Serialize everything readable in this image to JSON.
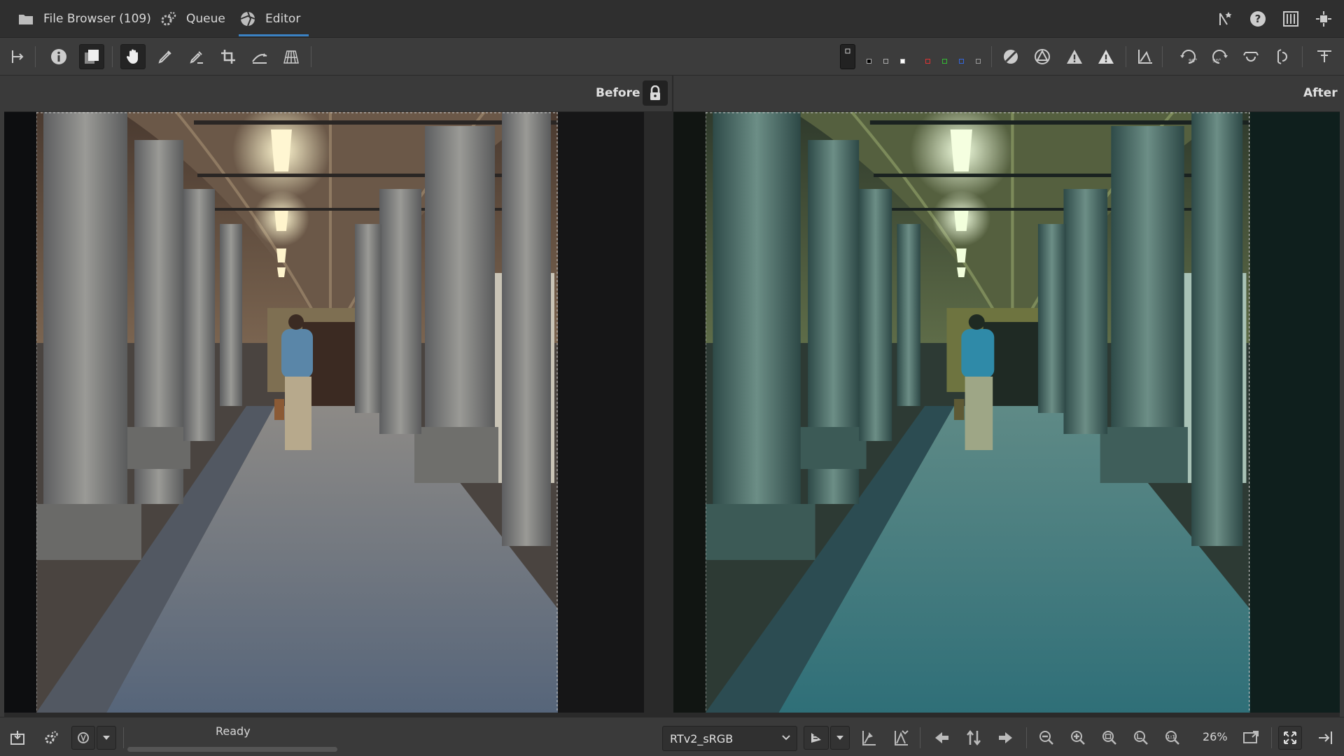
{
  "tabs": [
    {
      "label": "File Browser (109)",
      "icon": "folder-icon"
    },
    {
      "label": "Queue",
      "icon": "gears-icon"
    },
    {
      "label": "Editor",
      "icon": "aperture-icon",
      "active": true
    }
  ],
  "topbar_right_icons": [
    "add-star-icon",
    "help-icon",
    "panel-toggle-icon",
    "fullscreen-icon"
  ],
  "toolbar": {
    "left_icons": [
      "history-panel-icon",
      "info-icon",
      "before-after-icon",
      "hand-tool-icon",
      "color-picker-icon",
      "spot-removal-icon",
      "crop-icon",
      "straighten-icon",
      "perspective-icon"
    ],
    "pressed": [
      "before-after-icon",
      "hand-tool-icon"
    ],
    "right_icons": [
      "focus-mask-icon",
      "clip-shadow-icon",
      "clip-highlight-icon",
      "warning-shadow-icon",
      "warning-highlight-icon",
      "histogram-icon",
      "rotate-left-icon",
      "rotate-right-icon",
      "flip-horizontal-icon",
      "flip-vertical-icon",
      "expand-panel-icon"
    ],
    "swatch_colors": [
      "#000000",
      "#ffffff",
      "#ff0000",
      "#00aa00",
      "#0000ff",
      "#777777"
    ]
  },
  "viewer": {
    "before_label": "Before",
    "after_label": "After",
    "lock_icon": "lock-icon"
  },
  "status": {
    "text": "Ready",
    "output_profile": "RTv2_sRGB",
    "zoom": "26%"
  },
  "colors": {
    "accent": "#3a82c4",
    "background": "#3a3a3a",
    "tabbar": "#2f2f2f"
  }
}
